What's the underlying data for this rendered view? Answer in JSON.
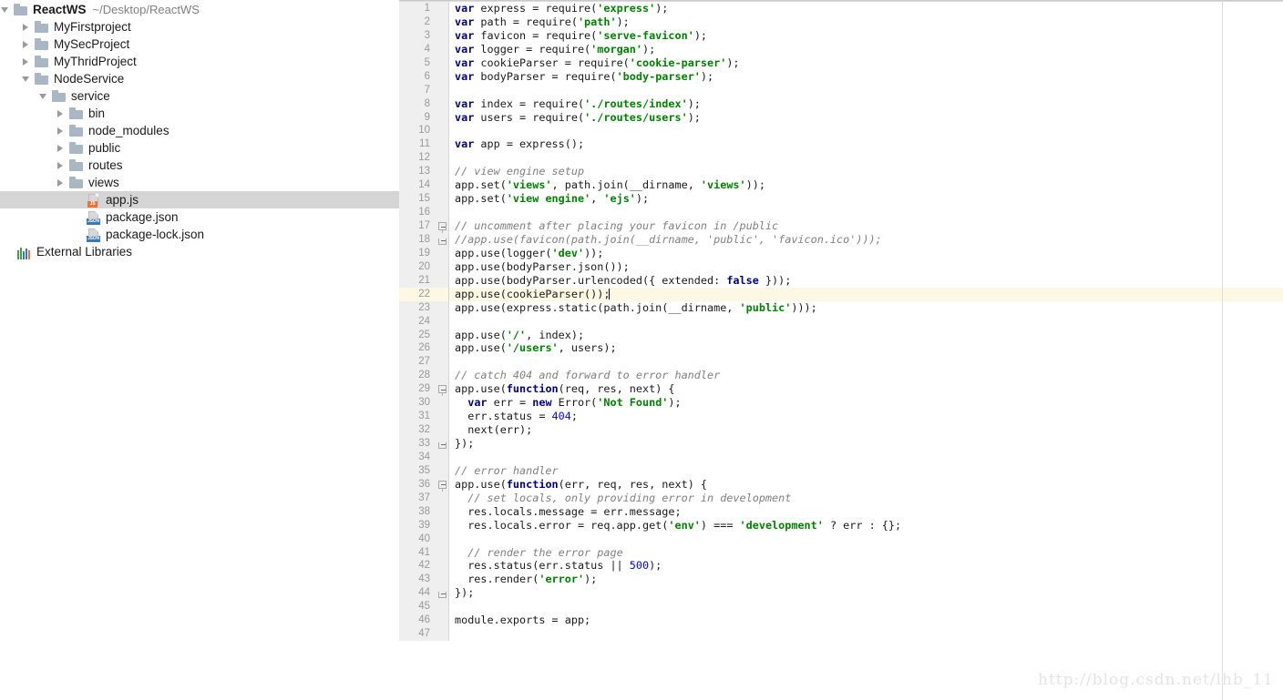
{
  "sidebar": {
    "root": {
      "label": "ReactWS",
      "path": "~/Desktop/ReactWS",
      "twisty": "down",
      "icon": "folder-icon"
    },
    "items": [
      {
        "label": "MyFirstproject",
        "indent": 1,
        "twisty": "right",
        "icon": "folder-icon",
        "selected": false
      },
      {
        "label": "MySecProject",
        "indent": 1,
        "twisty": "right",
        "icon": "folder-icon",
        "selected": false
      },
      {
        "label": "MyThridProject",
        "indent": 1,
        "twisty": "right",
        "icon": "folder-icon",
        "selected": false
      },
      {
        "label": "NodeService",
        "indent": 1,
        "twisty": "down",
        "icon": "folder-icon",
        "selected": false
      },
      {
        "label": "service",
        "indent": 2,
        "twisty": "down",
        "icon": "folder-icon",
        "selected": false
      },
      {
        "label": "bin",
        "indent": 3,
        "twisty": "right",
        "icon": "folder-icon",
        "selected": false
      },
      {
        "label": "node_modules",
        "indent": 3,
        "twisty": "right",
        "icon": "folder-icon",
        "selected": false
      },
      {
        "label": "public",
        "indent": 3,
        "twisty": "right",
        "icon": "folder-icon",
        "selected": false
      },
      {
        "label": "routes",
        "indent": 3,
        "twisty": "right",
        "icon": "folder-icon",
        "selected": false
      },
      {
        "label": "views",
        "indent": 3,
        "twisty": "right",
        "icon": "folder-icon",
        "selected": false
      },
      {
        "label": "app.js",
        "indent": 4,
        "twisty": "none",
        "icon": "js-file-icon",
        "badge": "JS",
        "selected": true
      },
      {
        "label": "package.json",
        "indent": 4,
        "twisty": "none",
        "icon": "json-file-icon",
        "badge": "JSON",
        "selected": false
      },
      {
        "label": "package-lock.json",
        "indent": 4,
        "twisty": "none",
        "icon": "json-file-icon",
        "badge": "JSON",
        "selected": false
      },
      {
        "label": "External Libraries",
        "indent": 0,
        "twisty": "none",
        "icon": "external-libraries-icon",
        "selected": false
      }
    ],
    "colors": {
      "selection": "#d5d5d5",
      "folder": "#a9b6c4",
      "js_badge": "#e8743b",
      "json_badge": "#3c78b4"
    }
  },
  "editor": {
    "current_line": 22,
    "colors": {
      "keyword": "#000080",
      "string": "#008000",
      "number": "#0000ff",
      "comment": "#808080",
      "current_line_bg": "#fcf8e4",
      "gutter_bg": "#efefef"
    },
    "lines": [
      {
        "n": 1,
        "html": "<span class=\"kw\">var</span> express = require(<span class=\"str\">'express'</span>);"
      },
      {
        "n": 2,
        "html": "<span class=\"kw\">var</span> path = require(<span class=\"str\">'path'</span>);"
      },
      {
        "n": 3,
        "html": "<span class=\"kw\">var</span> favicon = require(<span class=\"str\">'serve-favicon'</span>);"
      },
      {
        "n": 4,
        "html": "<span class=\"kw\">var</span> logger = require(<span class=\"str\">'morgan'</span>);"
      },
      {
        "n": 5,
        "html": "<span class=\"kw\">var</span> cookieParser = require(<span class=\"str\">'cookie-parser'</span>);"
      },
      {
        "n": 6,
        "html": "<span class=\"kw\">var</span> bodyParser = require(<span class=\"str\">'body-parser'</span>);"
      },
      {
        "n": 7,
        "html": ""
      },
      {
        "n": 8,
        "html": "<span class=\"kw\">var</span> index = require(<span class=\"str\">'./routes/index'</span>);"
      },
      {
        "n": 9,
        "html": "<span class=\"kw\">var</span> users = require(<span class=\"str\">'./routes/users'</span>);"
      },
      {
        "n": 10,
        "html": ""
      },
      {
        "n": 11,
        "html": "<span class=\"kw\">var</span> app = express();"
      },
      {
        "n": 12,
        "html": ""
      },
      {
        "n": 13,
        "html": "<span class=\"cmt\">// view engine setup</span>"
      },
      {
        "n": 14,
        "html": "app.set(<span class=\"str\">'views'</span>, path.join(__dirname, <span class=\"str\">'views'</span>));"
      },
      {
        "n": 15,
        "html": "app.set(<span class=\"str\">'view engine'</span>, <span class=\"str\">'ejs'</span>);"
      },
      {
        "n": 16,
        "html": ""
      },
      {
        "n": 17,
        "html": "<span class=\"cmt\">// uncomment after placing your favicon in /public</span>",
        "fold": "top"
      },
      {
        "n": 18,
        "html": "<span class=\"cmt\">//app.use(favicon(path.join(__dirname, 'public', 'favicon.ico')));</span>",
        "fold": "end"
      },
      {
        "n": 19,
        "html": "app.use(logger(<span class=\"str\">'dev'</span>));"
      },
      {
        "n": 20,
        "html": "app.use(bodyParser.json());"
      },
      {
        "n": 21,
        "html": "app.use(bodyParser.urlencoded({ extended: <span class=\"kw\">false</span> }));"
      },
      {
        "n": 22,
        "html": "app.use(cookieParser());<span class=\"cursor\"></span>",
        "current": true
      },
      {
        "n": 23,
        "html": "app.use(express.static(path.join(__dirname, <span class=\"str\">'public'</span>)));"
      },
      {
        "n": 24,
        "html": ""
      },
      {
        "n": 25,
        "html": "app.use(<span class=\"str\">'/'</span>, index);"
      },
      {
        "n": 26,
        "html": "app.use(<span class=\"str\">'/users'</span>, users);"
      },
      {
        "n": 27,
        "html": ""
      },
      {
        "n": 28,
        "html": "<span class=\"cmt\">// catch 404 and forward to error handler</span>"
      },
      {
        "n": 29,
        "html": "app.use(<span class=\"kw\">function</span>(req, res, next) {",
        "fold": "top"
      },
      {
        "n": 30,
        "html": "  <span class=\"kw\">var</span> err = <span class=\"kw\">new</span> Error(<span class=\"str\">'Not Found'</span>);"
      },
      {
        "n": 31,
        "html": "  err.status = <span class=\"num\">404</span>;"
      },
      {
        "n": 32,
        "html": "  next(err);"
      },
      {
        "n": 33,
        "html": "});",
        "fold": "end"
      },
      {
        "n": 34,
        "html": ""
      },
      {
        "n": 35,
        "html": "<span class=\"cmt\">// error handler</span>"
      },
      {
        "n": 36,
        "html": "app.use(<span class=\"kw\">function</span>(err, req, res, next) {",
        "fold": "top"
      },
      {
        "n": 37,
        "html": "  <span class=\"cmt\">// set locals, only providing error in development</span>"
      },
      {
        "n": 38,
        "html": "  res.locals.message = err.message;"
      },
      {
        "n": 39,
        "html": "  res.locals.error = req.app.get(<span class=\"str\">'env'</span>) === <span class=\"str\">'development'</span> ? err : {};"
      },
      {
        "n": 40,
        "html": ""
      },
      {
        "n": 41,
        "html": "  <span class=\"cmt\">// render the error page</span>"
      },
      {
        "n": 42,
        "html": "  res.status(err.status || <span class=\"num\">500</span>);"
      },
      {
        "n": 43,
        "html": "  res.render(<span class=\"str\">'error'</span>);"
      },
      {
        "n": 44,
        "html": "});",
        "fold": "end"
      },
      {
        "n": 45,
        "html": ""
      },
      {
        "n": 46,
        "html": "module.exports = app;"
      },
      {
        "n": 47,
        "html": ""
      }
    ]
  },
  "watermark": {
    "text": "http://blog.csdn.net/lhb_11"
  }
}
